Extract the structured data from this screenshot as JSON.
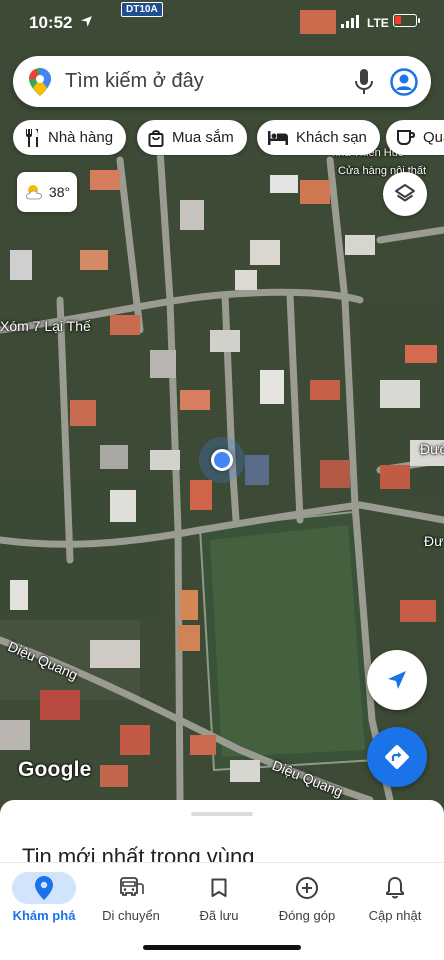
{
  "status_bar": {
    "time": "10:52",
    "network": "LTE"
  },
  "road_shield": "DT10A",
  "search": {
    "placeholder": "Tìm kiếm ở đây"
  },
  "chips": [
    {
      "label": "Nhà hàng",
      "icon": "fork-knife-icon"
    },
    {
      "label": "Mua sắm",
      "icon": "shopping-bag-icon"
    },
    {
      "label": "Khách sạn",
      "icon": "bed-icon"
    },
    {
      "label": "Quá",
      "icon": "coffee-icon"
    }
  ],
  "weather": {
    "temp": "38°"
  },
  "map_labels": {
    "street_1": "Xóm 7 Lại Thế",
    "street_2": "Diệu Quang",
    "street_3": "Diệu Quang",
    "poi_1": "nhà Thiên Huế",
    "poi_2": "Cửa hàng nội thất",
    "edge_1": "Đườ",
    "edge_2": "Đư"
  },
  "logo": "Google",
  "sheet": {
    "title": "Tin mới nhất trong vùng"
  },
  "bottom_nav": [
    {
      "label": "Khám phá",
      "icon": "location-pin-icon",
      "active": true
    },
    {
      "label": "Di chuyển",
      "icon": "car-icon",
      "active": false
    },
    {
      "label": "Đã lưu",
      "icon": "bookmark-icon",
      "active": false
    },
    {
      "label": "Đóng góp",
      "icon": "plus-circle-icon",
      "active": false
    },
    {
      "label": "Cập nhật",
      "icon": "bell-icon",
      "active": false
    }
  ],
  "colors": {
    "accent": "#1a73e8",
    "active_pill": "#d2e3fc"
  }
}
